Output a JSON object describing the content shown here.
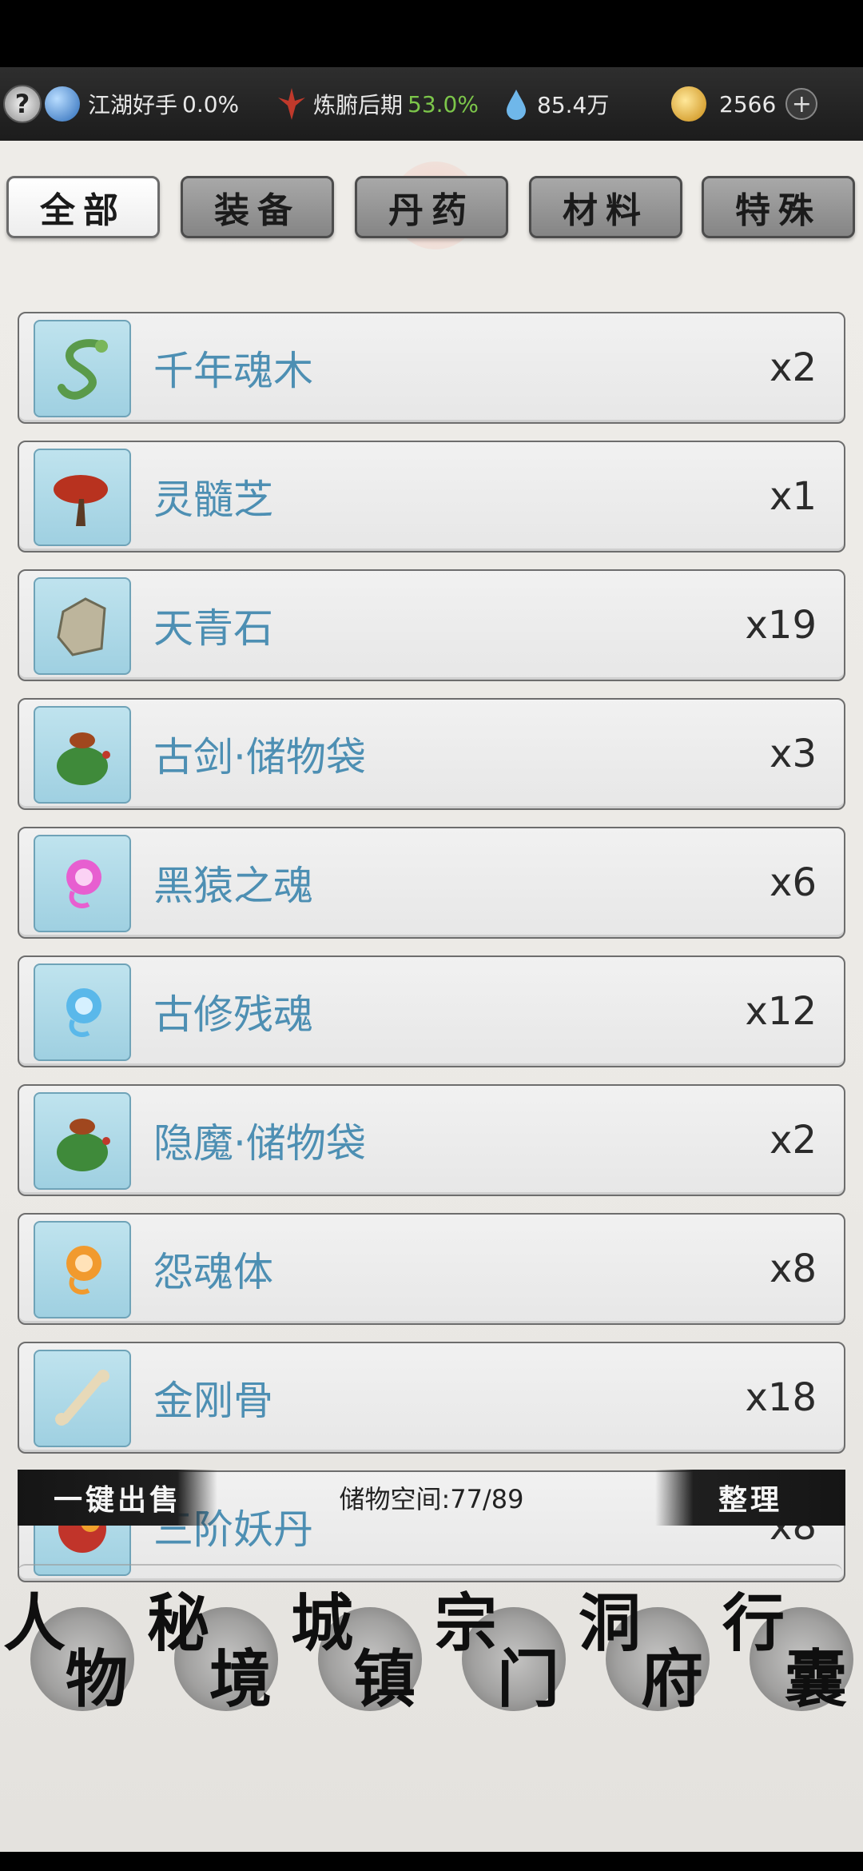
{
  "topbar": {
    "jianghu_label": "江湖好手",
    "jianghu_value": "0.0%",
    "realm_label": "炼腑后期",
    "realm_value": "53.0%",
    "spirit_stones": "85.4万",
    "coins": "2566",
    "plus": "+",
    "help": "?"
  },
  "tabs": [
    {
      "label": "全部",
      "active": true
    },
    {
      "label": "装备",
      "active": false
    },
    {
      "label": "丹药",
      "active": false
    },
    {
      "label": "材料",
      "active": false
    },
    {
      "label": "特殊",
      "active": false
    }
  ],
  "items": [
    {
      "name": "千年魂木",
      "count": "x2",
      "icon": "vine-wood-icon"
    },
    {
      "name": "灵髓芝",
      "count": "x1",
      "icon": "red-mushroom-icon"
    },
    {
      "name": "天青石",
      "count": "x19",
      "icon": "stone-icon"
    },
    {
      "name": "古剑·储物袋",
      "count": "x3",
      "icon": "storage-bag-icon"
    },
    {
      "name": "黑猿之魂",
      "count": "x6",
      "icon": "pink-spirit-icon"
    },
    {
      "name": "古修残魂",
      "count": "x12",
      "icon": "blue-spirit-icon"
    },
    {
      "name": "隐魔·储物袋",
      "count": "x2",
      "icon": "storage-bag-icon"
    },
    {
      "name": "怨魂体",
      "count": "x8",
      "icon": "orange-spirit-icon"
    },
    {
      "name": "金刚骨",
      "count": "x18",
      "icon": "bone-icon"
    },
    {
      "name": "三阶妖丹",
      "count": "x8",
      "icon": "demon-core-icon"
    }
  ],
  "actions": {
    "sell_all": "一键出售",
    "storage_label": "储物空间:77/89",
    "sort": "整理"
  },
  "nav": [
    {
      "c1": "人",
      "c2": "物"
    },
    {
      "c1": "秘",
      "c2": "境"
    },
    {
      "c1": "城",
      "c2": "镇"
    },
    {
      "c1": "宗",
      "c2": "门"
    },
    {
      "c1": "洞",
      "c2": "府"
    },
    {
      "c1": "行",
      "c2": "囊"
    }
  ]
}
